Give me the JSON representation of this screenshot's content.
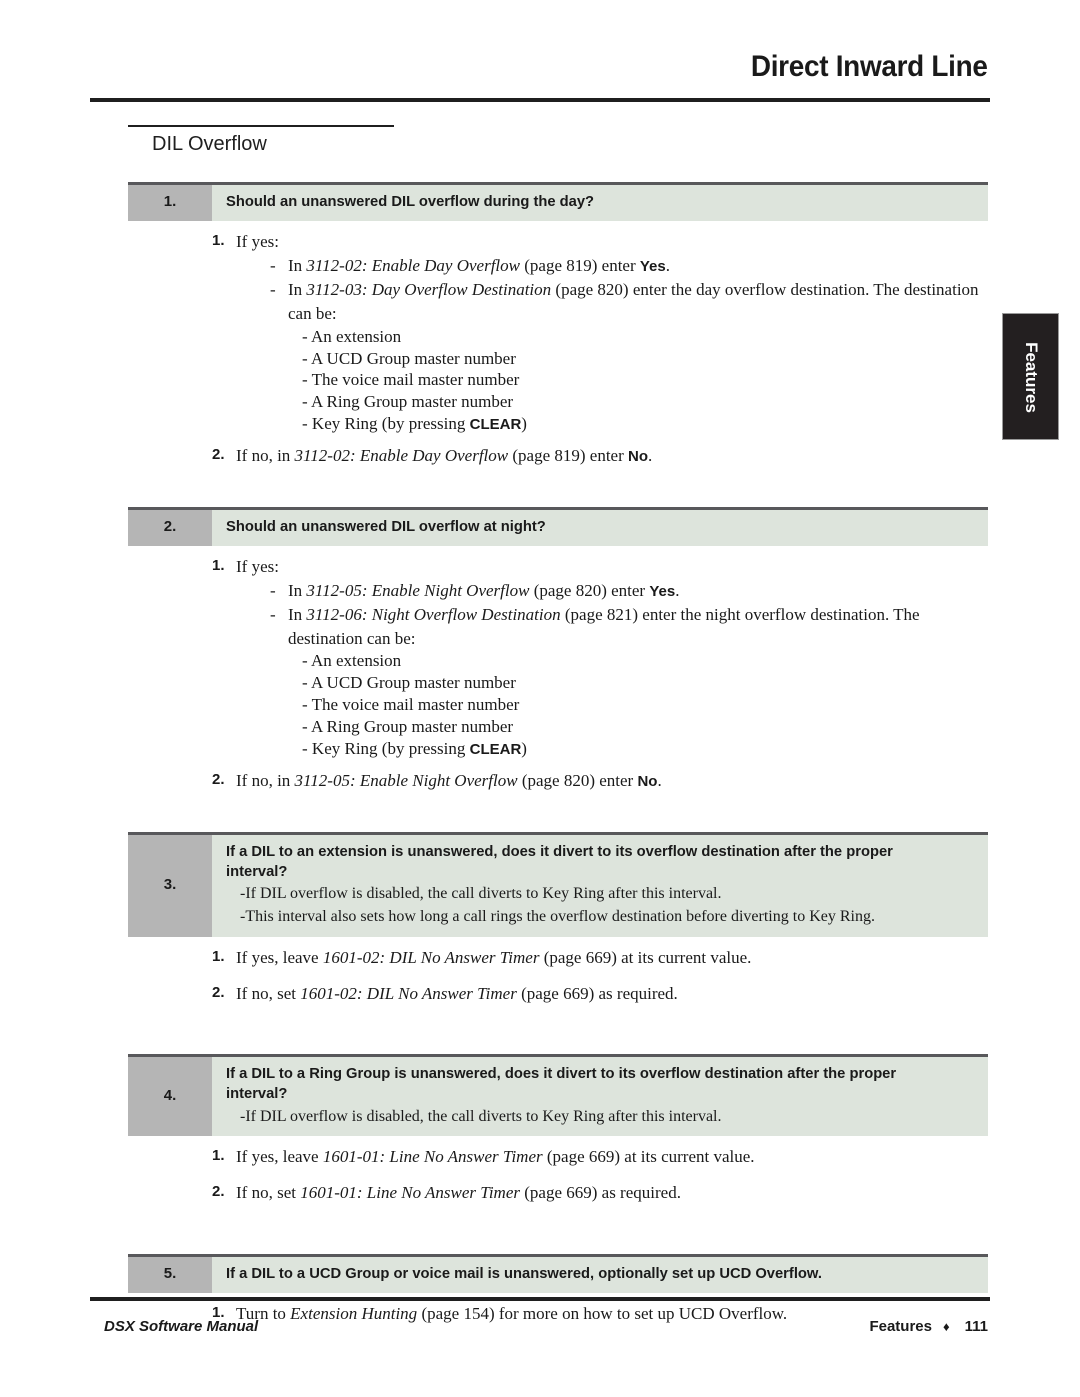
{
  "header": {
    "title": "Direct Inward Line"
  },
  "section": {
    "title": "DIL Overflow"
  },
  "side_tab": {
    "label": "Features"
  },
  "colors": {
    "number_cell": "#b5b5b5",
    "question_cell": "#dde4dc",
    "rule": "#1f1f1f",
    "banner_top_border": "#58585b",
    "side_tab_bg": "#231f20"
  },
  "items": [
    {
      "number": "1.",
      "question": "Should an unanswered DIL overflow during the day?",
      "notes": [],
      "answers": [
        {
          "number": "1.",
          "text": "If yes:",
          "dashes": [
            {
              "lead": "In ",
              "ref": "3112-02: Enable Day Overflow",
              "mid": " (page 819) enter ",
              "kbd": "Yes",
              "tail": "."
            },
            {
              "lead": "In ",
              "ref": "3112-03: Day Overflow Destination",
              "mid": " (page 820) enter the day overflow destination. The destination can be:",
              "kbd": "",
              "tail": "",
              "sub": [
                "- An extension",
                "- A UCD Group master number",
                "- The voice mail master number",
                "- A Ring Group master number"
              ],
              "sub_last": {
                "lead": "- Key Ring (by pressing ",
                "kbd": "CLEAR",
                "tail": ")"
              }
            }
          ]
        },
        {
          "number": "2.",
          "lead": "If no, in ",
          "ref": "3112-02: Enable Day Overflow",
          "mid": " (page 819) enter ",
          "kbd": "No",
          "tail": "."
        }
      ]
    },
    {
      "number": "2.",
      "question": "Should an unanswered DIL overflow at night?",
      "notes": [],
      "answers": [
        {
          "number": "1.",
          "text": "If yes:",
          "dashes": [
            {
              "lead": "In ",
              "ref": "3112-05: Enable Night Overflow",
              "mid": " (page 820) enter ",
              "kbd": "Yes",
              "tail": "."
            },
            {
              "lead": "In ",
              "ref": "3112-06: Night Overflow Destination",
              "mid": " (page 821) enter the night overflow destination. The destination can be:",
              "kbd": "",
              "tail": "",
              "sub": [
                "- An extension",
                "- A UCD Group master number",
                "- The voice mail master number",
                "- A Ring Group master number"
              ],
              "sub_last": {
                "lead": "- Key Ring (by pressing ",
                "kbd": "CLEAR",
                "tail": ")"
              }
            }
          ]
        },
        {
          "number": "2.",
          "lead": "If no, in ",
          "ref": "3112-05: Enable Night Overflow",
          "mid": " (page 820) enter ",
          "kbd": "No",
          "tail": "."
        }
      ]
    },
    {
      "number": "3.",
      "question": "If a DIL to an extension is unanswered, does it divert to its overflow destination after the proper interval?",
      "notes": [
        "-If DIL overflow is disabled, the call diverts to Key Ring after this interval.",
        "-This interval also sets how long a call rings the overflow destination before diverting to Key Ring."
      ],
      "answers": [
        {
          "number": "1.",
          "lead": "If yes, leave ",
          "ref": "1601-02: DIL No Answer Timer",
          "mid": " (page 669) at its current value.",
          "kbd": "",
          "tail": ""
        },
        {
          "number": "2.",
          "lead": "If no, set ",
          "ref": "1601-02: DIL No Answer Timer",
          "mid": " (page 669) as required.",
          "kbd": "",
          "tail": ""
        }
      ]
    },
    {
      "number": "4.",
      "question": "If a DIL to a Ring Group is unanswered, does it divert to its overflow destination after the proper interval?",
      "notes": [
        "-If DIL overflow is disabled, the call diverts to Key Ring after this interval."
      ],
      "answers": [
        {
          "number": "1.",
          "lead": "If yes, leave ",
          "ref": "1601-01: Line No Answer Timer",
          "mid": " (page 669) at its current value.",
          "kbd": "",
          "tail": ""
        },
        {
          "number": "2.",
          "lead": "If no, set ",
          "ref": "1601-01: Line No Answer Timer",
          "mid": " (page 669) as required.",
          "kbd": "",
          "tail": ""
        }
      ]
    },
    {
      "number": "5.",
      "question": "If a DIL to a UCD Group or voice mail is unanswered, optionally set up UCD Overflow.",
      "notes": [],
      "answers": [
        {
          "number": "1.",
          "lead": "Turn to ",
          "ref": "Extension Hunting",
          "mid": " (page 154) for more on how to set up UCD Overflow.",
          "kbd": "",
          "tail": ""
        }
      ]
    }
  ],
  "footer": {
    "left": "DSX Software Manual",
    "right_label": "Features",
    "diamond": "♦",
    "page": "111"
  }
}
